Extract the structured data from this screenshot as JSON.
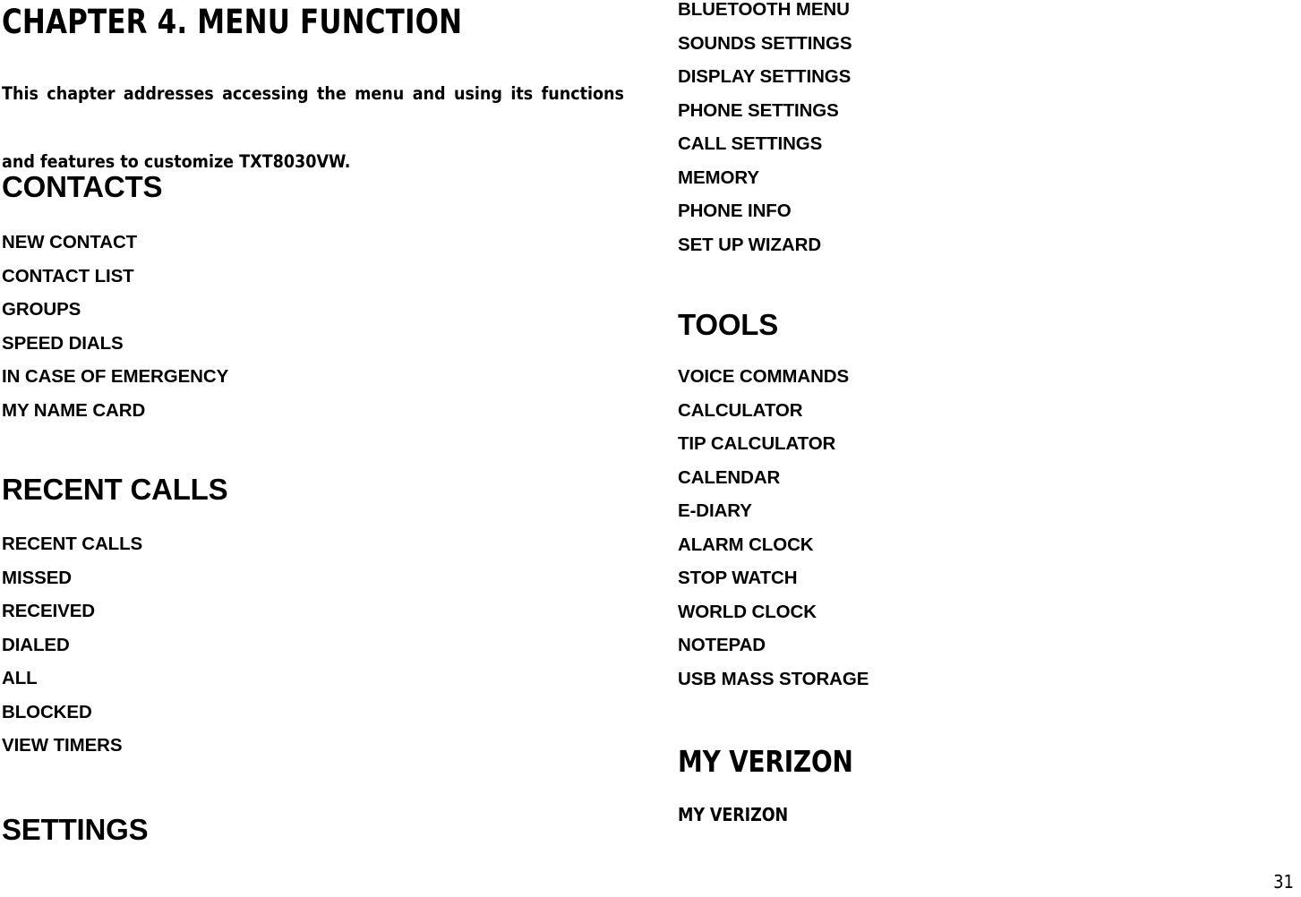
{
  "document": {
    "chapter_title": "CHAPTER 4. MENU FUNCTION",
    "intro_line_1": "This chapter addresses accessing the menu and using its functions",
    "intro_line_2": "and features to customize TXT8030VW.",
    "page_number": "31"
  },
  "sections": {
    "contacts": {
      "heading": "CONTACTS",
      "items": [
        "NEW CONTACT",
        "CONTACT LIST",
        "GROUPS",
        "SPEED DIALS",
        "IN CASE OF EMERGENCY",
        "MY NAME CARD"
      ]
    },
    "recent_calls": {
      "heading": "RECENT CALLS",
      "items": [
        "RECENT CALLS",
        "MISSED",
        "RECEIVED",
        "DIALED",
        "ALL",
        "BLOCKED",
        "VIEW TIMERS"
      ]
    },
    "settings": {
      "heading": "SETTINGS",
      "items": [
        "BLUETOOTH MENU",
        "SOUNDS SETTINGS",
        "DISPLAY SETTINGS",
        "PHONE SETTINGS",
        "CALL SETTINGS",
        "MEMORY",
        "PHONE INFO",
        "SET UP WIZARD"
      ]
    },
    "tools": {
      "heading": "TOOLS",
      "items": [
        "VOICE COMMANDS",
        "CALCULATOR",
        "TIP CALCULATOR",
        "CALENDAR",
        "E-DIARY",
        "ALARM CLOCK",
        "STOP WATCH",
        "WORLD CLOCK",
        "NOTEPAD",
        "USB MASS STORAGE"
      ]
    },
    "my_verizon": {
      "heading": "MY VERIZON",
      "items": [
        "MY VERIZON"
      ]
    }
  },
  "colors": {
    "text": "#000000",
    "background": "#ffffff"
  }
}
